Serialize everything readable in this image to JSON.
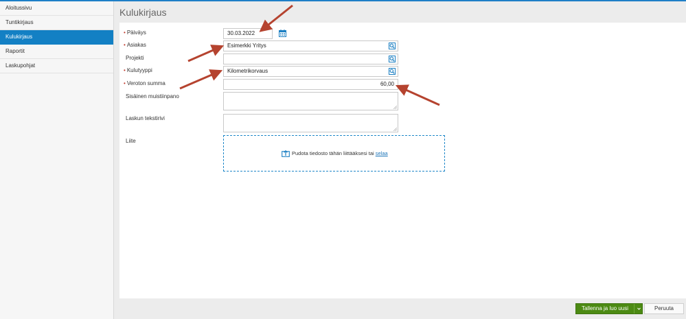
{
  "sidebar": {
    "items": [
      {
        "label": "Aloitussivu"
      },
      {
        "label": "Tuntikirjaus"
      },
      {
        "label": "Kulukirjaus"
      },
      {
        "label": "Raportit"
      },
      {
        "label": "Laskupohjat"
      }
    ],
    "active_index": 2
  },
  "page": {
    "title": "Kulukirjaus"
  },
  "form": {
    "date": {
      "label": "Päiväys",
      "value": "30.03.2022",
      "required": true
    },
    "customer": {
      "label": "Asiakas",
      "value": "Esimerkki Yritys",
      "required": true
    },
    "project": {
      "label": "Projekti",
      "value": "",
      "required": false
    },
    "expense_type": {
      "label": "Kulutyyppi",
      "value": "Kilometrikorvaus",
      "required": true
    },
    "amount": {
      "label": "Veroton summa",
      "value": "60,00",
      "required": true
    },
    "internal_note": {
      "label": "Sisäinen muistiinpano",
      "value": ""
    },
    "invoice_text": {
      "label": "Laskun tekstirivi",
      "value": ""
    },
    "attachment": {
      "label": "Liite",
      "drop_text": "Pudota tiedosto tähän liittääksesi tai",
      "browse_link": "selaa"
    }
  },
  "footer": {
    "save_label": "Tallenna ja luo uusi",
    "cancel_label": "Peruuta"
  },
  "colors": {
    "accent": "#1380c4",
    "save_button": "#4c8a13",
    "annotation_arrow": "#b5432f"
  },
  "icons": {
    "date_picker": "calendar-icon",
    "lookup": "search-list-icon",
    "upload": "upload-icon",
    "split_menu": "chevron-down-icon"
  }
}
